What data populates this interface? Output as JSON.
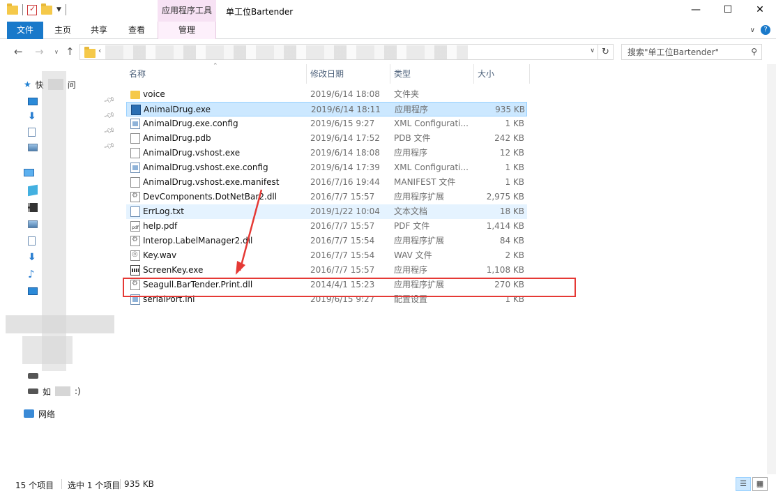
{
  "window": {
    "title": "单工位Bartender",
    "context_tab_group": "应用程序工具",
    "controls": {
      "minimize": "—",
      "maximize": "☐",
      "close": "✕"
    }
  },
  "ribbon": {
    "tabs": [
      {
        "label": "文件"
      },
      {
        "label": "主页"
      },
      {
        "label": "共享"
      },
      {
        "label": "查看"
      },
      {
        "label": "管理"
      }
    ]
  },
  "address": {
    "search_placeholder": "搜索\"单工位Bartender\""
  },
  "nav_pane": {
    "quick_access_label": "快",
    "quick_access_suffix": "问",
    "network_label": "网络",
    "drive2_label": "如",
    "drive2_suffix": ":)"
  },
  "columns": {
    "name": "名称",
    "date": "修改日期",
    "type": "类型",
    "size": "大小"
  },
  "files": [
    {
      "name": "voice",
      "date": "2019/6/14 18:08",
      "type": "文件夹",
      "size": "",
      "icon": "folder"
    },
    {
      "name": "AnimalDrug.exe",
      "date": "2019/6/14 18:11",
      "type": "应用程序",
      "size": "935 KB",
      "icon": "exe",
      "selected": true
    },
    {
      "name": "AnimalDrug.exe.config",
      "date": "2019/6/15 9:27",
      "type": "XML Configurati...",
      "size": "1 KB",
      "icon": "config"
    },
    {
      "name": "AnimalDrug.pdb",
      "date": "2019/6/14 17:52",
      "type": "PDB 文件",
      "size": "242 KB",
      "icon": "file"
    },
    {
      "name": "AnimalDrug.vshost.exe",
      "date": "2019/6/14 18:08",
      "type": "应用程序",
      "size": "12 KB",
      "icon": "exe-plain"
    },
    {
      "name": "AnimalDrug.vshost.exe.config",
      "date": "2019/6/14 17:39",
      "type": "XML Configurati...",
      "size": "1 KB",
      "icon": "config"
    },
    {
      "name": "AnimalDrug.vshost.exe.manifest",
      "date": "2016/7/16 19:44",
      "type": "MANIFEST 文件",
      "size": "1 KB",
      "icon": "file"
    },
    {
      "name": "DevComponents.DotNetBar2.dll",
      "date": "2016/7/7 15:57",
      "type": "应用程序扩展",
      "size": "2,975 KB",
      "icon": "dll"
    },
    {
      "name": "ErrLog.txt",
      "date": "2019/1/22 10:04",
      "type": "文本文档",
      "size": "18 KB",
      "icon": "txt",
      "hover": true
    },
    {
      "name": "help.pdf",
      "date": "2016/7/7 15:57",
      "type": "PDF 文件",
      "size": "1,414 KB",
      "icon": "pdf"
    },
    {
      "name": "Interop.LabelManager2.dll",
      "date": "2016/7/7 15:54",
      "type": "应用程序扩展",
      "size": "84 KB",
      "icon": "dll"
    },
    {
      "name": "Key.wav",
      "date": "2016/7/7 15:54",
      "type": "WAV 文件",
      "size": "2 KB",
      "icon": "wav"
    },
    {
      "name": "ScreenKey.exe",
      "date": "2016/7/7 15:57",
      "type": "应用程序",
      "size": "1,108 KB",
      "icon": "keyboard"
    },
    {
      "name": "Seagull.BarTender.Print.dll",
      "date": "2014/4/1 15:23",
      "type": "应用程序扩展",
      "size": "270 KB",
      "icon": "dll",
      "highlighted": true
    },
    {
      "name": "serialPort.ini",
      "date": "2019/6/15 9:27",
      "type": "配置设置",
      "size": "1 KB",
      "icon": "config"
    }
  ],
  "status": {
    "item_count": "15 个项目",
    "selected_count": "选中 1 个项目",
    "selected_size": "935 KB"
  },
  "colors": {
    "file_tab": "#1979ca",
    "context_tab": "#f7e2f4",
    "selection": "#cce8ff",
    "annotation_red": "#e53935"
  }
}
